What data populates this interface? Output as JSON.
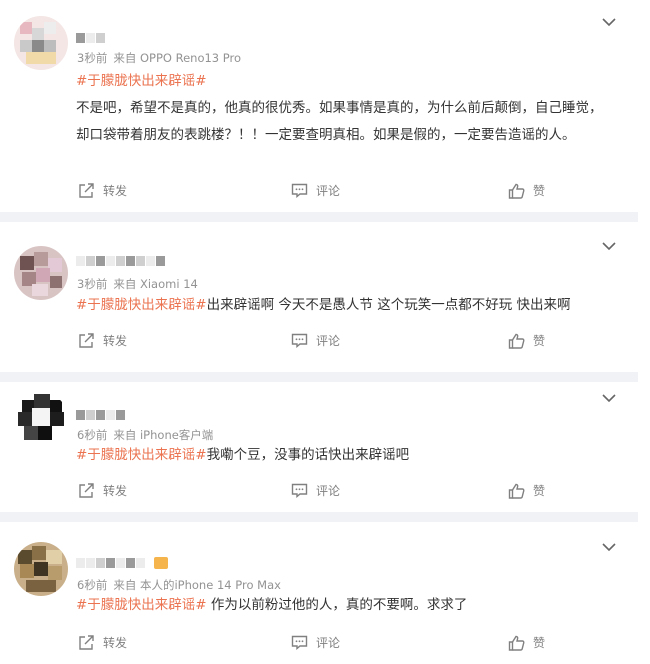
{
  "colors": {
    "topic": "#eb7350",
    "meta": "#939393",
    "separator": "#f1f2f5"
  },
  "comments": [
    {
      "time": "3秒前",
      "source": "来自 OPPO Reno13 Pro",
      "topic": "#于朦胧快出来辟谣#",
      "text": "不是吧，希望不是真的，他真的很优秀。如果事情是真的，为什么前后颠倒，自己睡觉，却口袋带着朋友的表跳楼？！！一定要查明真相。如果是假的，一定要告造谣的人。",
      "actions": {
        "repost": "转发",
        "comment": "评论",
        "like": "赞"
      }
    },
    {
      "time": "3秒前",
      "source": "来自 Xiaomi 14",
      "topic": "#于朦胧快出来辟谣#",
      "text": "出来辟谣啊 今天不是愚人节 这个玩笑一点都不好玩 快出来啊",
      "actions": {
        "repost": "转发",
        "comment": "评论",
        "like": "赞"
      }
    },
    {
      "time": "6秒前",
      "source": "来自 iPhone客户端",
      "topic": "#于朦胧快出来辟谣#",
      "text": "我嘞个豆，没事的话快出来辟谣吧",
      "actions": {
        "repost": "转发",
        "comment": "评论",
        "like": "赞"
      }
    },
    {
      "time": "6秒前",
      "source": "来自 本人的iPhone 14 Pro Max",
      "topic": "#于朦胧快出来辟谣#",
      "text": " 作为以前粉过他的人，真的不要啊。求求了",
      "actions": {
        "repost": "转发",
        "comment": "评论",
        "like": "赞"
      }
    }
  ],
  "icons": {
    "repost": "repost-icon",
    "comment": "comment-icon",
    "like": "thumbs-up-icon",
    "menu": "chevron-down-icon"
  }
}
